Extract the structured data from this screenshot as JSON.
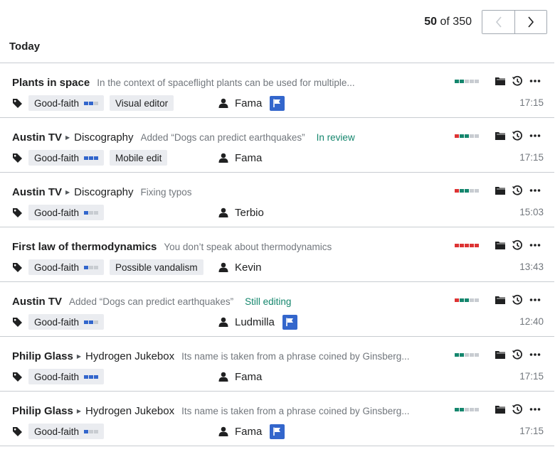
{
  "pager": {
    "current": "50",
    "of_label": "of",
    "total": "350",
    "prev_icon": "chevron-left-icon",
    "next_icon": "chevron-right-icon"
  },
  "day_heading": "Today",
  "colors": {
    "green": "#14866d",
    "red": "#d33",
    "gray": "#c8ccd1",
    "blue": "#3366cc",
    "flag": "#3366cc",
    "status_text": "#14866d"
  },
  "rows": [
    {
      "title": "Plants in space",
      "subtitle": "",
      "summary": "In the context of spaceflight plants can be used for multiple...",
      "status": "",
      "score": [
        "green",
        "green",
        "gray",
        "gray",
        "gray"
      ],
      "tags": [
        {
          "label": "Good-faith",
          "dots": [
            "blue",
            "blue",
            "gray"
          ]
        },
        {
          "label": "Visual editor"
        }
      ],
      "user": "Fama",
      "flag": true,
      "time": "17:15"
    },
    {
      "title": "Austin TV",
      "subtitle": "Discography",
      "summary": "Added “Dogs can predict earthquakes”",
      "status": "In review",
      "score": [
        "red",
        "green",
        "green",
        "gray",
        "gray"
      ],
      "tags": [
        {
          "label": "Good-faith",
          "dots": [
            "blue",
            "blue",
            "blue"
          ]
        },
        {
          "label": "Mobile edit"
        }
      ],
      "user": "Fama",
      "flag": false,
      "time": "17:15"
    },
    {
      "title": "Austin TV",
      "subtitle": "Discography",
      "summary": "Fixing typos",
      "status": "",
      "score": [
        "red",
        "green",
        "green",
        "gray",
        "gray"
      ],
      "tags": [
        {
          "label": "Good-faith",
          "dots": [
            "blue",
            "gray",
            "gray"
          ]
        }
      ],
      "user": "Terbio",
      "flag": false,
      "time": "15:03"
    },
    {
      "title": "First law of thermodynamics",
      "subtitle": "",
      "summary": "You don’t speak about thermodynamics",
      "status": "",
      "score": [
        "red",
        "red",
        "red",
        "red",
        "red"
      ],
      "tags": [
        {
          "label": "Good-faith",
          "dots": [
            "blue",
            "gray",
            "gray"
          ]
        },
        {
          "label": "Possible vandalism"
        }
      ],
      "user": "Kevin",
      "flag": false,
      "time": "13:43"
    },
    {
      "title": "Austin TV",
      "subtitle": "",
      "summary": "Added “Dogs can predict earthquakes”",
      "status": "Still editing",
      "score": [
        "red",
        "green",
        "green",
        "gray",
        "gray"
      ],
      "tags": [
        {
          "label": "Good-faith",
          "dots": [
            "blue",
            "blue",
            "gray"
          ]
        }
      ],
      "user": "Ludmilla",
      "flag": true,
      "time": "12:40"
    },
    {
      "title": "Philip Glass",
      "subtitle": "Hydrogen Jukebox",
      "summary": "Its name is taken from a phrase coined by Ginsberg...",
      "status": "",
      "score": [
        "green",
        "green",
        "gray",
        "gray",
        "gray"
      ],
      "tags": [
        {
          "label": "Good-faith",
          "dots": [
            "blue",
            "blue",
            "blue"
          ]
        }
      ],
      "user": "Fama",
      "flag": false,
      "time": "17:15"
    },
    {
      "title": "Philip Glass",
      "subtitle": "Hydrogen Jukebox",
      "summary": "Its name is taken from a phrase coined by Ginsberg...",
      "status": "",
      "score": [
        "green",
        "green",
        "gray",
        "gray",
        "gray"
      ],
      "tags": [
        {
          "label": "Good-faith",
          "dots": [
            "blue",
            "gray",
            "gray"
          ]
        }
      ],
      "user": "Fama",
      "flag": true,
      "time": "17:15"
    }
  ],
  "icons": {
    "tag": "tag-icon",
    "user": "user-icon",
    "flag": "flag-icon",
    "folder": "folder-icon",
    "history": "history-icon",
    "more": "more-icon"
  }
}
